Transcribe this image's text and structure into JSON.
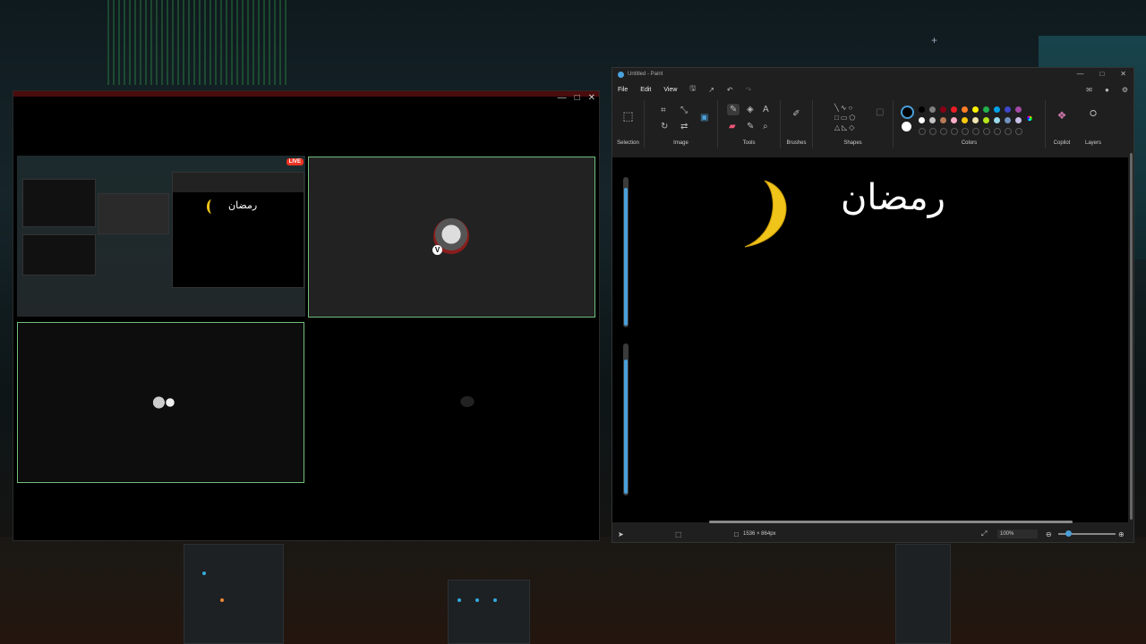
{
  "left_window": {
    "live_badge": "LIVE",
    "participant_badge": "V",
    "mini_text": "رمضان",
    "controls": [
      "—",
      "□",
      "✕"
    ]
  },
  "paint": {
    "title": "Untitled - Paint",
    "window_controls": [
      "—",
      "□",
      "✕"
    ],
    "menu": [
      "File",
      "Edit",
      "View"
    ],
    "groups": {
      "selection": "Selection",
      "image": "Image",
      "tools": "Tools",
      "brushes": "Brushes",
      "shapes": "Shapes",
      "colors": "Colors",
      "copilot": "Copilot",
      "layers": "Layers"
    },
    "canvas_text": "رمضان",
    "status": {
      "canvas_size": "1536 × 864px",
      "zoom": "100%"
    },
    "colors": {
      "row1": [
        "#000000",
        "#7f7f7f",
        "#880015",
        "#ed1c24",
        "#ff7f27",
        "#fff200",
        "#22b14c",
        "#00a2e8",
        "#3f48cc",
        "#a349a4"
      ],
      "row2": [
        "#ffffff",
        "#c3c3c3",
        "#b97a57",
        "#ffaec9",
        "#ffc90e",
        "#efe4b0",
        "#b5e61d",
        "#99d9ea",
        "#7092be",
        "#c8bfe7"
      ],
      "moon": "#f0c419",
      "accent": "#4a9fd8",
      "active_border": "#6fbf7a"
    }
  }
}
